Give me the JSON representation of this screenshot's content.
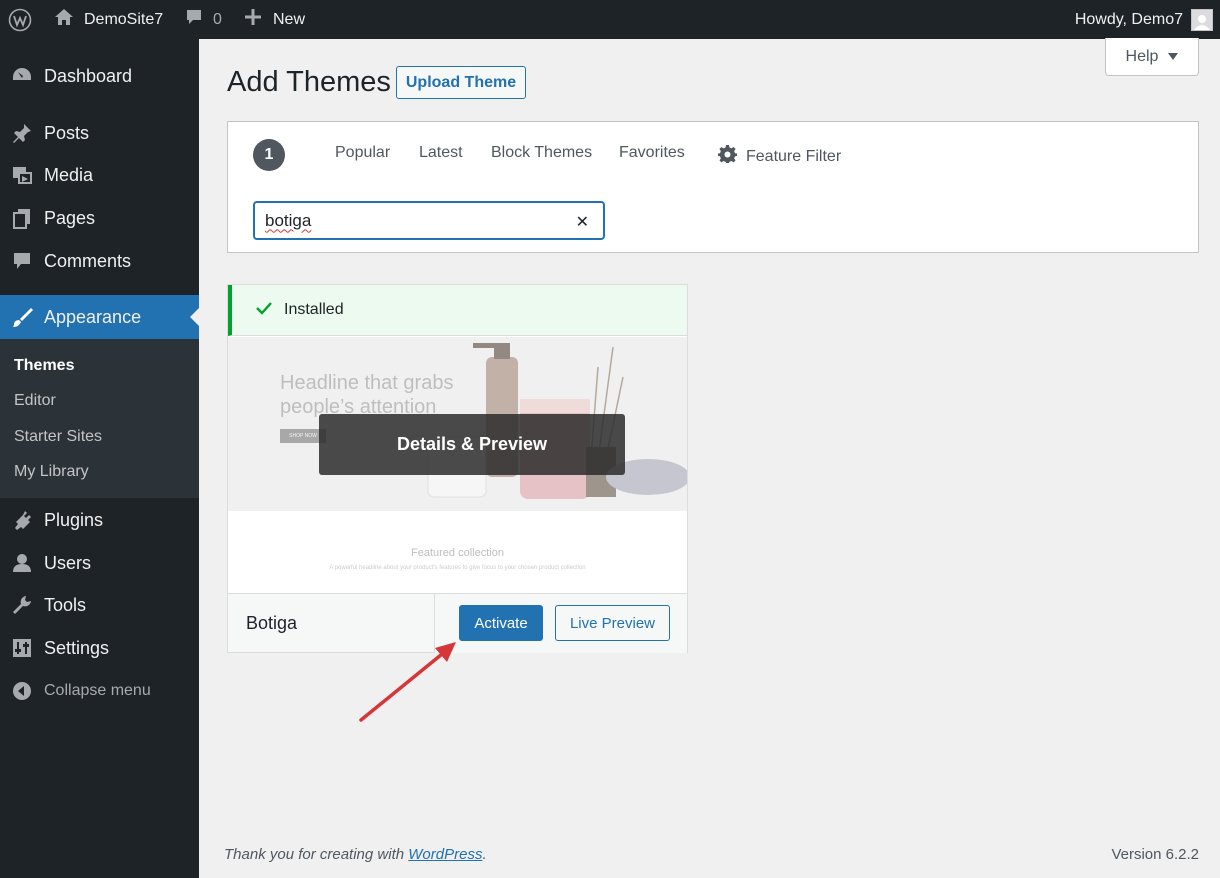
{
  "admin_bar": {
    "site_name": "DemoSite7",
    "comments_count": "0",
    "new_label": "New",
    "howdy": "Howdy, Demo7"
  },
  "sidebar": {
    "items": [
      {
        "label": "Dashboard",
        "icon": "dashboard-icon"
      },
      {
        "label": "Posts",
        "icon": "pin-icon"
      },
      {
        "label": "Media",
        "icon": "media-icon"
      },
      {
        "label": "Pages",
        "icon": "pages-icon"
      },
      {
        "label": "Comments",
        "icon": "comment-icon"
      },
      {
        "label": "Appearance",
        "icon": "paintbrush-icon",
        "current": true
      },
      {
        "label": "Plugins",
        "icon": "plug-icon"
      },
      {
        "label": "Users",
        "icon": "users-icon"
      },
      {
        "label": "Tools",
        "icon": "wrench-icon"
      },
      {
        "label": "Settings",
        "icon": "sliders-icon"
      }
    ],
    "submenu": [
      "Themes",
      "Editor",
      "Starter Sites",
      "My Library"
    ],
    "collapse_label": "Collapse menu"
  },
  "header": {
    "title": "Add Themes",
    "upload_button": "Upload Theme",
    "help_button": "Help"
  },
  "filter": {
    "count": "1",
    "links": [
      "Popular",
      "Latest",
      "Block Themes",
      "Favorites"
    ],
    "feature_filter": "Feature Filter",
    "search_value": "botiga",
    "clear_symbol": "✕"
  },
  "theme": {
    "installed_label": "Installed",
    "preview_headline": "Headline that grabs people’s attention",
    "preview_button": "SHOP NOW",
    "featured_title": "Featured collection",
    "featured_sub": "A powerful headline about your product's features to give focus to your chosen product collection",
    "details_button": "Details & Preview",
    "name": "Botiga",
    "activate_button": "Activate",
    "live_preview_button": "Live Preview"
  },
  "footer": {
    "thanks_prefix": "Thank you for creating with ",
    "thanks_link": "WordPress",
    "thanks_suffix": ".",
    "version": "Version 6.2.2"
  },
  "colors": {
    "accent": "#2271b1",
    "admin_dark": "#1d2327",
    "success": "#00a32a",
    "annotation_arrow": "#d63638"
  }
}
